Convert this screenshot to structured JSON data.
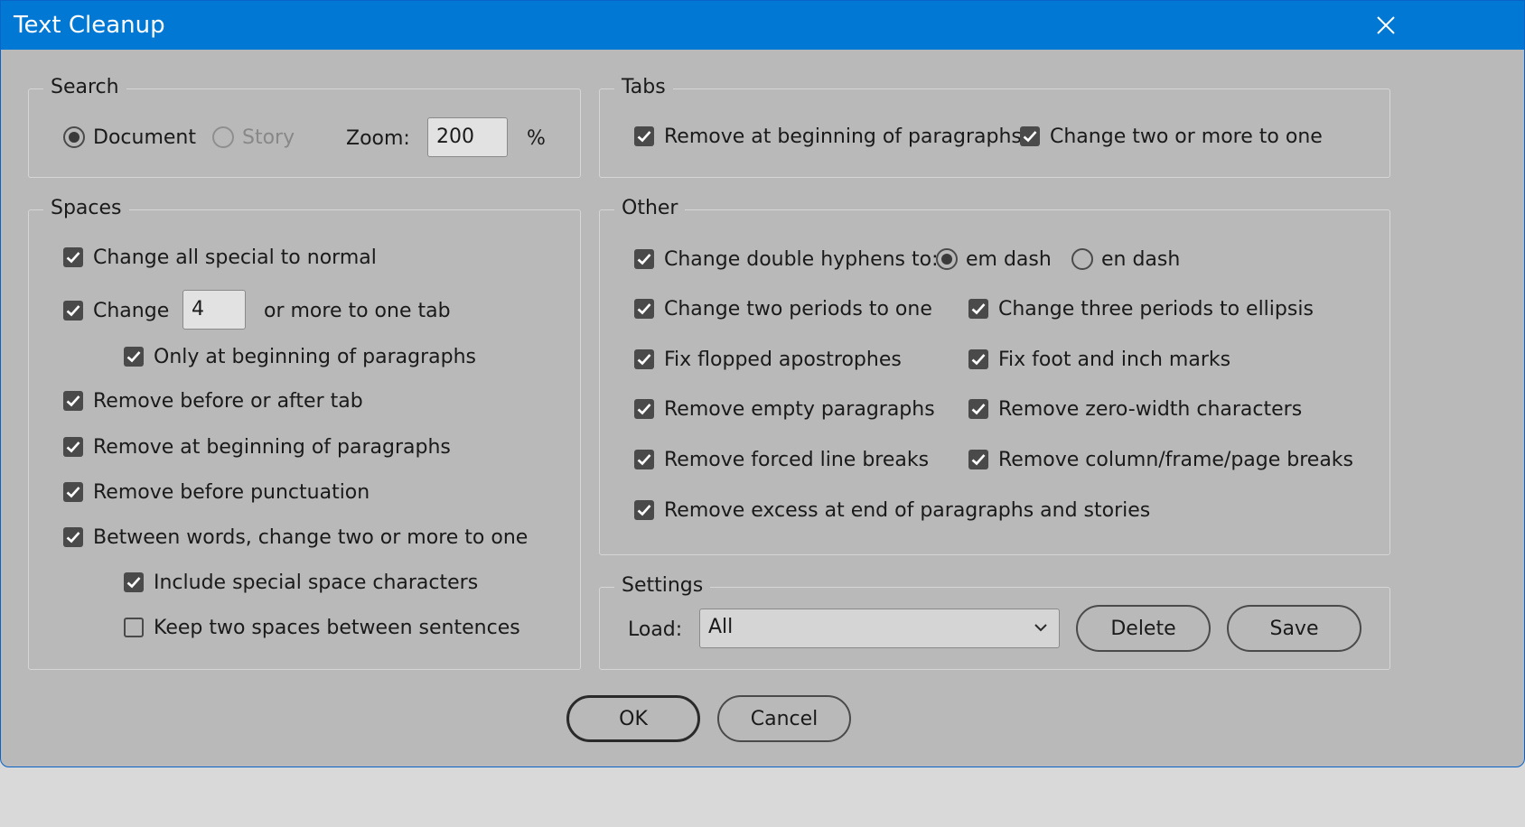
{
  "window": {
    "title": "Text Cleanup"
  },
  "search": {
    "legend": "Search",
    "document_label": "Document",
    "story_label": "Story",
    "zoom_label": "Zoom:",
    "zoom_value": "200",
    "zoom_unit": "%"
  },
  "tabs": {
    "legend": "Tabs",
    "remove_beginning": "Remove at beginning of paragraphs",
    "change_two_more": "Change two or more to one"
  },
  "spaces": {
    "legend": "Spaces",
    "change_special": "Change all special to normal",
    "change_label": "Change",
    "change_count": "4",
    "change_suffix": "or more to one tab",
    "only_beginning": "Only at beginning of paragraphs",
    "remove_around_tab": "Remove before or after tab",
    "remove_beginning": "Remove at beginning of paragraphs",
    "remove_punctuation": "Remove before punctuation",
    "between_words": "Between words, change two or more to one",
    "include_special": "Include special space characters",
    "keep_two": "Keep two spaces between sentences"
  },
  "other": {
    "legend": "Other",
    "double_hyphens": "Change double hyphens to:",
    "em_dash": "em dash",
    "en_dash": "en dash",
    "two_periods": "Change two periods to one",
    "three_periods": "Change three periods to ellipsis",
    "flopped": "Fix flopped apostrophes",
    "foot_inch": "Fix foot and inch marks",
    "empty_paragraphs": "Remove empty paragraphs",
    "zero_width": "Remove zero-width characters",
    "forced_breaks": "Remove forced line breaks",
    "column_breaks": "Remove column/frame/page breaks",
    "excess_end": "Remove excess at end of paragraphs and stories"
  },
  "settings": {
    "legend": "Settings",
    "load_label": "Load:",
    "load_value": "All",
    "delete_label": "Delete",
    "save_label": "Save"
  },
  "footer": {
    "ok_label": "OK",
    "cancel_label": "Cancel"
  }
}
